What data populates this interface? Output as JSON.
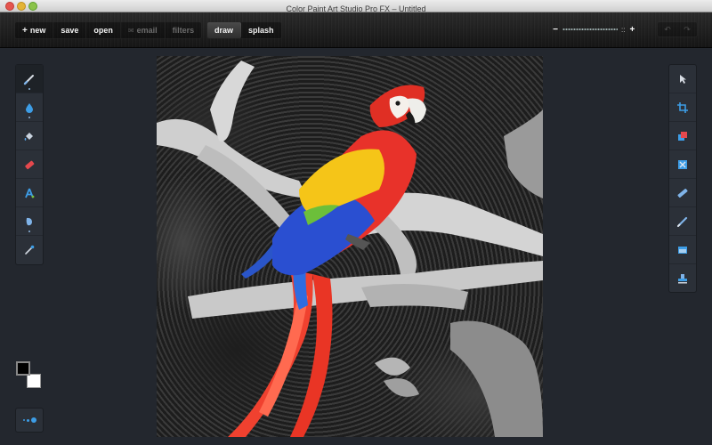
{
  "window": {
    "title": "Color Paint Art Studio Pro FX – Untitled"
  },
  "toolbar": {
    "file_group": {
      "new_label": "new",
      "save_label": "save",
      "open_label": "open",
      "email_label": "email",
      "filters_label": "filters"
    },
    "mode_group": {
      "draw_label": "draw",
      "splash_label": "splash",
      "active": "draw"
    },
    "zoom": {
      "minus_label": "−",
      "plus_label": "+",
      "fit_label": "::"
    },
    "undo_icon": "undo-arrow-icon",
    "redo_icon": "redo-arrow-icon"
  },
  "left_tools": [
    {
      "name": "brush",
      "icon": "brush-icon",
      "selected": true
    },
    {
      "name": "water-drop",
      "icon": "water-drop-icon"
    },
    {
      "name": "fill-bucket",
      "icon": "fill-bucket-icon"
    },
    {
      "name": "eraser",
      "icon": "eraser-icon"
    },
    {
      "name": "text",
      "icon": "text-icon"
    },
    {
      "name": "smudge",
      "icon": "smudge-icon"
    },
    {
      "name": "eyedropper",
      "icon": "eyedropper-icon"
    }
  ],
  "right_tools": [
    {
      "name": "select",
      "icon": "cursor-icon"
    },
    {
      "name": "crop",
      "icon": "crop-icon"
    },
    {
      "name": "layers",
      "icon": "layers-icon"
    },
    {
      "name": "transform",
      "icon": "transform-icon"
    },
    {
      "name": "ruler",
      "icon": "ruler-icon"
    },
    {
      "name": "pencil",
      "icon": "pencil-icon"
    },
    {
      "name": "window",
      "icon": "window-icon"
    },
    {
      "name": "stamp",
      "icon": "stamp-icon"
    }
  ],
  "colors": {
    "foreground": "#000000",
    "background": "#ffffff",
    "accent": "#3d9de6"
  }
}
